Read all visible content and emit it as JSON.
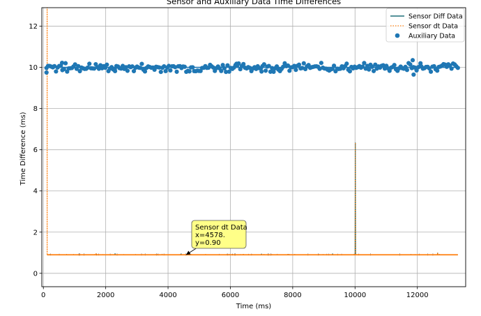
{
  "chart_data": {
    "type": "line",
    "title": "Sensor and Auxiliary Data Time Differences",
    "xlabel": "Time (ms)",
    "ylabel": "Time Difference (ms)",
    "xlim": [
      -50,
      13550
    ],
    "ylim": [
      -0.65,
      12.9
    ],
    "x_ticks": [
      0,
      2000,
      4000,
      6000,
      8000,
      10000,
      12000
    ],
    "y_ticks": [
      0,
      2,
      4,
      6,
      8,
      10,
      12
    ],
    "grid": true,
    "legend_position": "top-right",
    "colors": {
      "sensor_diff": "#1f6f78",
      "sensor_dt": "#ff7f0e",
      "auxiliary": "#1f77b4",
      "annotation_bg": "#ffff88"
    },
    "series": [
      {
        "name": "Sensor Diff Data",
        "style": "solid-line",
        "baseline": 0.9,
        "x_range": [
          120,
          13300
        ],
        "spikes": [
          [
            2300,
            0.97
          ],
          [
            4420,
            0.96
          ],
          [
            7000,
            0.95
          ],
          [
            9280,
            0.96
          ],
          [
            10010,
            6.35
          ],
          [
            12650,
            1.0
          ]
        ]
      },
      {
        "name": "Sensor dt Data",
        "style": "dotted-line",
        "baseline": 0.9,
        "x_range": [
          120,
          13300
        ],
        "spikes": [
          [
            120,
            12.9
          ],
          [
            1690,
            0.97
          ],
          [
            5200,
            0.95
          ],
          [
            6400,
            0.95
          ],
          [
            10010,
            6.35
          ],
          [
            12650,
            1.0
          ]
        ]
      },
      {
        "name": "Auxiliary Data",
        "style": "scatter",
        "baseline": 10.0,
        "x_range": [
          100,
          13300
        ],
        "count": 260,
        "jitter": 0.22,
        "outliers": [
          [
            100,
            9.75
          ],
          [
            600,
            10.22
          ],
          [
            2300,
            9.82
          ],
          [
            6200,
            10.18
          ],
          [
            7000,
            9.8
          ],
          [
            11850,
            10.35
          ],
          [
            11880,
            9.65
          ],
          [
            12100,
            10.2
          ]
        ]
      }
    ],
    "annotation": {
      "lines": [
        "Sensor dt Data",
        "x=4578.",
        "y=0.90"
      ],
      "point": [
        4578,
        0.9
      ]
    }
  }
}
